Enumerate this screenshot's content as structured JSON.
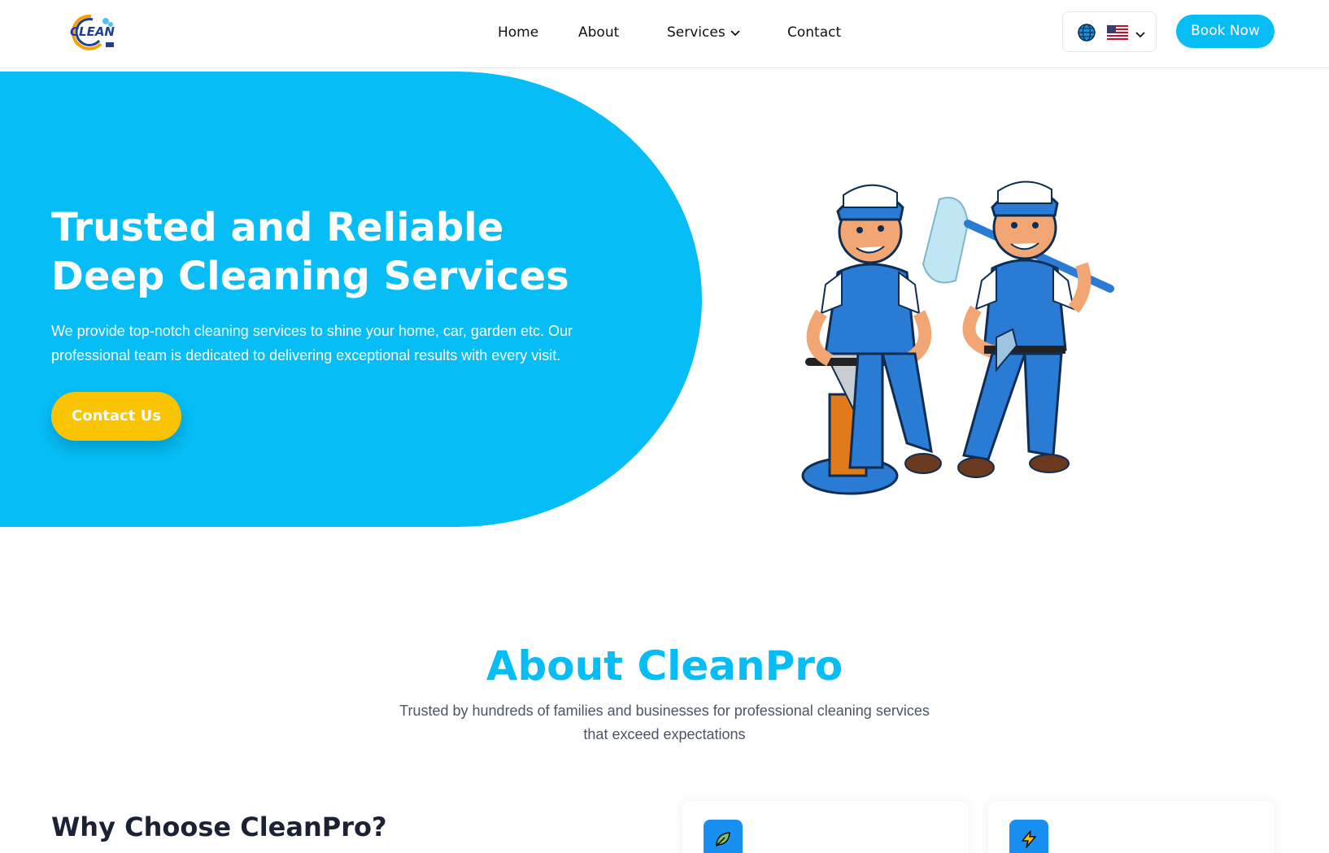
{
  "brand": {
    "logo_text": "CLEAN"
  },
  "nav": {
    "items": [
      "Home",
      "About",
      "Services",
      "Contact"
    ]
  },
  "header": {
    "book_label": "Book Now"
  },
  "hero": {
    "title": "Trusted and Reliable Deep Cleaning Services",
    "subtitle": "We provide top-notch cleaning services to shine your home, car, garden etc. Our professional team is dedicated to delivering exceptional results with every visit.",
    "cta_label": "Contact Us"
  },
  "about": {
    "title": "About CleanPro",
    "subtitle": "Trusted by hundreds of families and businesses for professional cleaning services that exceed expectations"
  },
  "why": {
    "title": "Why Choose CleanPro?"
  },
  "cards": [
    {
      "icon": "leaf-icon"
    },
    {
      "icon": "lightning-icon"
    }
  ],
  "colors": {
    "primary": "#06bdf6",
    "accent": "#fbc400",
    "card_icon_bg": "#1a8ff2"
  }
}
